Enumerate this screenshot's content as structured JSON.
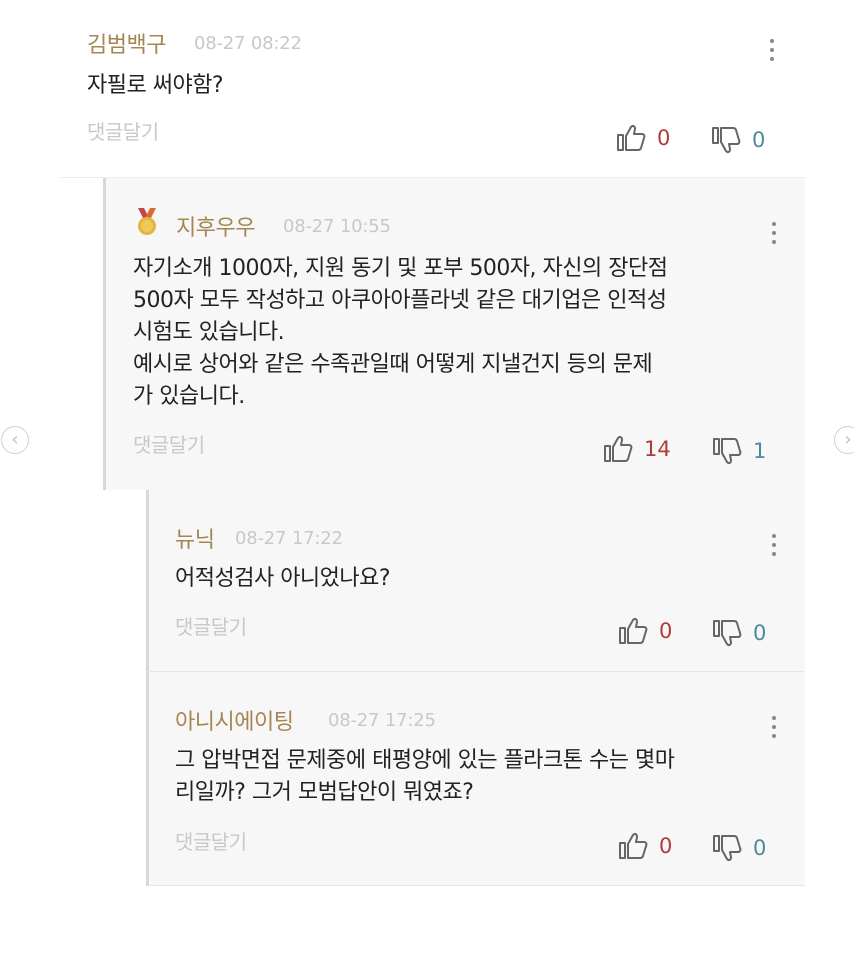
{
  "comments": [
    {
      "author": "김범백구",
      "timestamp": "08-27 08:22",
      "text": "자필로 써야함?",
      "reply_label": "댓글달기",
      "likes": "0",
      "dislikes": "0"
    },
    {
      "author": "지후우우",
      "timestamp": "08-27 10:55",
      "text": "자기소개 1000자, 지원 동기 및 포부 500자, 자신의 장단점\n500자 모두 작성하고 아쿠아아플라넷 같은 대기업은 인적성\n시험도 있습니다.\n예시로 상어와 같은 수족관일때 어떻게 지낼건지 등의 문제\n가 있습니다.",
      "reply_label": "댓글달기",
      "likes": "14",
      "dislikes": "1"
    },
    {
      "author": "뉴닉",
      "timestamp": "08-27 17:22",
      "text": "어적성검사 아니었나요?",
      "reply_label": "댓글달기",
      "likes": "0",
      "dislikes": "0"
    },
    {
      "author": "아니시에이팅",
      "timestamp": "08-27 17:25",
      "text": "그 압박면접 문제중에 태평양에 있는 플라크톤 수는 몇마\n리일까? 그거 모범답안이 뭐였죠?",
      "reply_label": "댓글달기",
      "likes": "0",
      "dislikes": "0"
    }
  ],
  "navigation": {
    "prev_icon": "‹",
    "next_icon": "›"
  },
  "icons": {
    "like": "thumbs-up-icon",
    "dislike": "thumbs-down-icon",
    "more": "more-vertical-icon",
    "badge": "medal-icon"
  },
  "colors": {
    "author": "#a58652",
    "like_count": "#b13a3a",
    "dislike_count": "#4a8a9c",
    "reply_bg": "#f7f7f7"
  }
}
